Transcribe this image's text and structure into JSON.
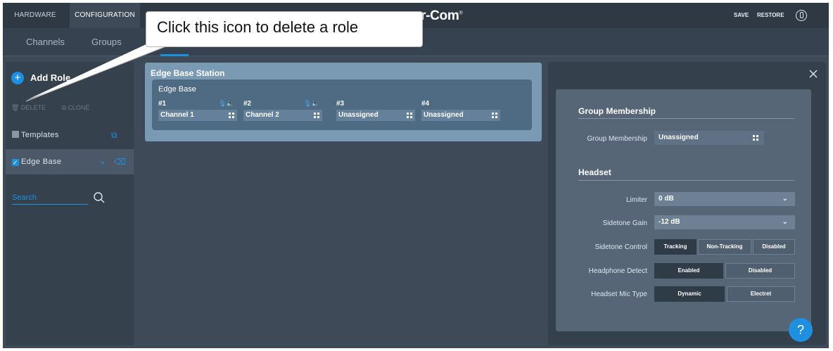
{
  "topbar": {
    "tabs": [
      "HARDWARE",
      "CONFIGURATION"
    ],
    "brand": "r-Com",
    "brand_mark": "®",
    "save": "SAVE",
    "restore": "RESTORE"
  },
  "subtabs": {
    "channels": "Channels",
    "groups": "Groups"
  },
  "sidebar": {
    "add_role": "Add Role",
    "plus": "+",
    "delete": "DELETE",
    "clone": "CLONE",
    "items": [
      {
        "label": "Templates",
        "checked": false
      },
      {
        "label": "Edge Base",
        "checked": true
      }
    ],
    "search_placeholder": "Search"
  },
  "station": {
    "title": "Edge Base Station",
    "subtitle": "Edge Base",
    "channels": [
      {
        "num": "#1",
        "value": "Channel 1",
        "has_icons": true
      },
      {
        "num": "#2",
        "value": "Channel 2",
        "has_icons": true
      },
      {
        "num": "#3",
        "value": "Unassigned",
        "has_icons": false
      },
      {
        "num": "#4",
        "value": "Unassigned",
        "has_icons": false
      }
    ]
  },
  "panel": {
    "group_section": "Group Membership",
    "group_label": "Group Membership",
    "group_value": "Unassigned",
    "headset_section": "Headset",
    "limiter_label": "Limiter",
    "limiter_value": "0 dB",
    "sidetone_gain_label": "Sidetone Gain",
    "sidetone_gain_value": "-12 dB",
    "sidetone_control_label": "Sidetone Control",
    "sidetone_control_options": [
      "Tracking",
      "Non-Tracking",
      "Disabled"
    ],
    "sidetone_control_selected": "Tracking",
    "headphone_detect_label": "Headphone Detect",
    "headphone_detect_options": [
      "Enabled",
      "Disabled"
    ],
    "headphone_detect_selected": "Enabled",
    "mic_type_label": "Headset Mic Type",
    "mic_type_options": [
      "Dynamic",
      "Electret"
    ],
    "mic_type_selected": "Dynamic"
  },
  "help": "?",
  "callout": {
    "text": "Click this icon to delete a role"
  },
  "colors": {
    "accent": "#1f8fe0",
    "bg": "#3e4a57",
    "topbar": "#2e3944"
  }
}
